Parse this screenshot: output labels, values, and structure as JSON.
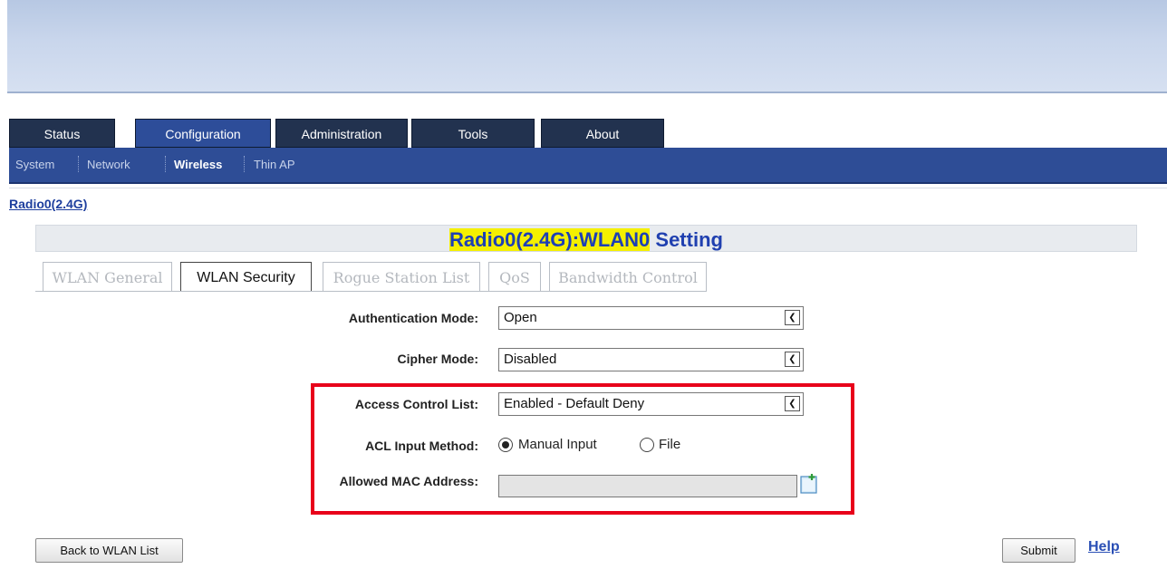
{
  "nav": {
    "tabs": [
      {
        "label": "Status",
        "active": false
      },
      {
        "label": "Configuration",
        "active": true
      },
      {
        "label": "Administration",
        "active": false
      },
      {
        "label": "Tools",
        "active": false
      },
      {
        "label": "About",
        "active": false
      }
    ],
    "subnav": [
      {
        "label": "System",
        "active": false
      },
      {
        "label": "Network",
        "active": false
      },
      {
        "label": "Wireless",
        "active": true
      },
      {
        "label": "Thin AP",
        "active": false
      }
    ]
  },
  "breadcrumb": "Radio0(2.4G)",
  "page": {
    "title_highlight": "Radio0(2.4G):WLAN0",
    "title_rest": " Setting"
  },
  "subtabs": [
    {
      "label": "WLAN General",
      "active": false
    },
    {
      "label": "WLAN Security",
      "active": true
    },
    {
      "label": "Rogue Station List",
      "active": false
    },
    {
      "label": "QoS",
      "active": false
    },
    {
      "label": "Bandwidth Control",
      "active": false
    }
  ],
  "form": {
    "auth_mode": {
      "label": "Authentication Mode:",
      "value": "Open"
    },
    "cipher_mode": {
      "label": "Cipher Mode:",
      "value": "Disabled"
    },
    "acl": {
      "label": "Access Control List:",
      "value": "Enabled - Default Deny"
    },
    "acl_input": {
      "label": "ACL Input Method:",
      "options": [
        {
          "label": "Manual Input",
          "selected": true
        },
        {
          "label": "File",
          "selected": false
        }
      ]
    },
    "allowed_mac": {
      "label": "Allowed MAC Address:",
      "value": ""
    }
  },
  "buttons": {
    "back": "Back to WLAN List",
    "submit": "Submit",
    "help": "Help"
  },
  "colors": {
    "highlight_box": "#e8001a",
    "nav_dark": "#22324f",
    "nav_active": "#2d4d99",
    "title_highlight_bg": "#f5f000"
  },
  "icons": {
    "select_arrow": "chevron-down-icon",
    "add_mac": "add-list-icon"
  }
}
